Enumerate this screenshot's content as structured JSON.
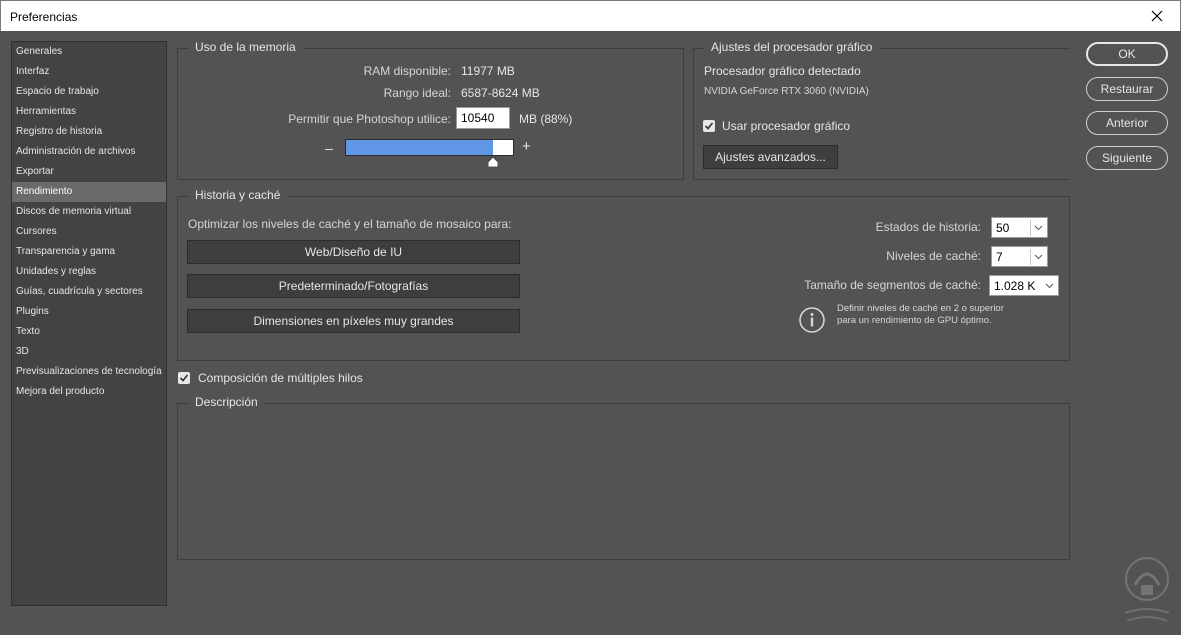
{
  "window": {
    "title": "Preferencias"
  },
  "sidebar": {
    "items": [
      {
        "label": "Generales",
        "selected": false
      },
      {
        "label": "Interfaz",
        "selected": false
      },
      {
        "label": "Espacio de trabajo",
        "selected": false
      },
      {
        "label": "Herramientas",
        "selected": false
      },
      {
        "label": "Registro de historia",
        "selected": false
      },
      {
        "label": "Administración de archivos",
        "selected": false
      },
      {
        "label": "Exportar",
        "selected": false
      },
      {
        "label": "Rendimiento",
        "selected": true
      },
      {
        "label": "Discos de memoria virtual",
        "selected": false
      },
      {
        "label": "Cursores",
        "selected": false
      },
      {
        "label": "Transparencia y gama",
        "selected": false
      },
      {
        "label": "Unidades y reglas",
        "selected": false
      },
      {
        "label": "Guías, cuadrícula y sectores",
        "selected": false
      },
      {
        "label": "Plugins",
        "selected": false
      },
      {
        "label": "Texto",
        "selected": false
      },
      {
        "label": "3D",
        "selected": false
      },
      {
        "label": "Previsualizaciones de tecnología",
        "selected": false
      },
      {
        "label": "Mejora del producto",
        "selected": false
      }
    ]
  },
  "memory": {
    "title": "Uso de la memoria",
    "ram_label": "RAM disponible:",
    "ram_value": "11977 MB",
    "ideal_label": "Rango ideal:",
    "ideal_value": "6587-8624 MB",
    "allow_label": "Permitir que Photoshop utilice:",
    "allow_value": "10540",
    "allow_unit": "MB (88%)",
    "slider_percent": 88,
    "minus": "–",
    "plus": "+"
  },
  "gpu": {
    "title": "Ajustes del procesador gráfico",
    "detected_label": "Procesador gráfico detectado",
    "gpu_name": "NVIDIA GeForce RTX 3060 (NVIDIA)",
    "use_gpu_label": "Usar procesador gráfico",
    "use_gpu_checked": true,
    "advanced_button": "Ajustes avanzados..."
  },
  "history": {
    "title": "Historia y caché",
    "optimize_label": "Optimizar los niveles de caché y el tamaño de mosaico para:",
    "preset_web": "Web/Diseño de IU",
    "preset_default": "Predeterminado/Fotografías",
    "preset_large": "Dimensiones en píxeles muy grandes",
    "states_label": "Estados de historia:",
    "states_value": "50",
    "cache_levels_label": "Niveles de caché:",
    "cache_levels_value": "7",
    "tile_size_label": "Tamaño de segmentos de caché:",
    "tile_size_value": "1.028 K",
    "info_text": "Definir niveles de caché en 2 o superior para un rendimiento de GPU óptimo."
  },
  "multithread": {
    "label": "Composición de múltiples hilos",
    "checked": true
  },
  "description": {
    "title": "Descripción"
  },
  "buttons": {
    "ok": "OK",
    "reset": "Restaurar",
    "prev": "Anterior",
    "next": "Siguiente"
  },
  "colors": {
    "panel": "#535353",
    "sidebar": "#434343",
    "selected": "#6a6a6a",
    "slider": "#5f96e6"
  }
}
